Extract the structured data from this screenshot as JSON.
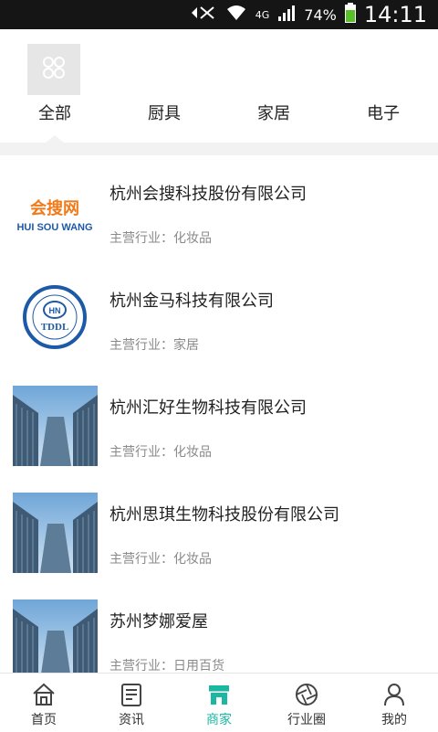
{
  "status_bar": {
    "battery": "74%",
    "network": "4G",
    "time": "14:11"
  },
  "categories": {
    "icon": "grid-icon",
    "tabs": [
      {
        "label": "全部"
      },
      {
        "label": "厨具"
      },
      {
        "label": "家居"
      },
      {
        "label": "电子"
      }
    ]
  },
  "companies": [
    {
      "name": "杭州会搜科技股份有限公司",
      "industry": "主营行业：化妆品",
      "logo_text": "会搜网",
      "logo_sub": "HUI SOU WANG"
    },
    {
      "name": "杭州金马科技有限公司",
      "industry": "主营行业：家居",
      "logo_text": "TDDL",
      "logo_sub": "HN"
    },
    {
      "name": "杭州汇好生物科技有限公司",
      "industry": "主营行业：化妆品"
    },
    {
      "name": "杭州思琪生物科技股份有限公司",
      "industry": "主营行业：化妆品"
    },
    {
      "name": "苏州梦娜爱屋",
      "industry": "主营行业：日用百货"
    }
  ],
  "bottom_nav": [
    {
      "label": "首页",
      "icon": "home-icon"
    },
    {
      "label": "资讯",
      "icon": "news-icon"
    },
    {
      "label": "商家",
      "icon": "shop-icon"
    },
    {
      "label": "行业圈",
      "icon": "aperture-icon"
    },
    {
      "label": "我的",
      "icon": "user-icon"
    }
  ],
  "colors": {
    "accent": "#1bb7a1",
    "logo_orange": "#f07a1a",
    "logo_blue": "#1c5aa8"
  }
}
